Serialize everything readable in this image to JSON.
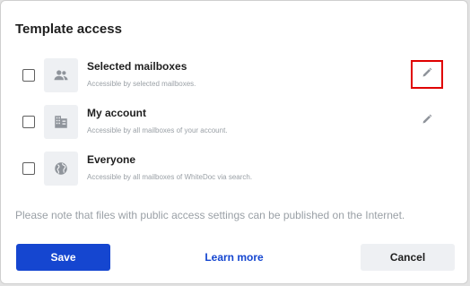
{
  "dialog": {
    "title": "Template access",
    "options": [
      {
        "label": "Selected mailboxes",
        "description": "Accessible by selected mailboxes.",
        "icon": "people-icon",
        "checked": false,
        "editable": true
      },
      {
        "label": "My account",
        "description": "Accessible by all mailboxes of your account.",
        "icon": "building-icon",
        "checked": false,
        "editable": true
      },
      {
        "label": "Everyone",
        "description": "Accessible by all mailboxes of WhiteDoc via search.",
        "icon": "globe-icon",
        "checked": false,
        "editable": false
      }
    ],
    "note": "Please note that files with public access settings can be published on the Internet.",
    "buttons": {
      "save": "Save",
      "learn_more": "Learn more",
      "cancel": "Cancel"
    }
  },
  "colors": {
    "primary": "#1546d0",
    "highlight": "#e00000",
    "muted": "#9aa0a6"
  }
}
